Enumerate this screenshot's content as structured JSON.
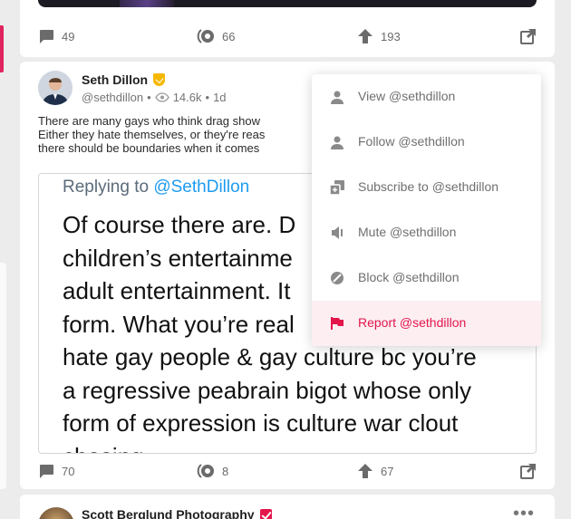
{
  "colors": {
    "accent": "#e3154b",
    "link": "#1d9bf0",
    "gold": "#f5b800",
    "background": "#ececec"
  },
  "post_above": {
    "comments": "49",
    "views": "66",
    "upvotes": "193"
  },
  "post": {
    "author_name": "Seth Dillon",
    "handle": "@sethdillon",
    "separator": "•",
    "views": "14.6k",
    "age": "1d",
    "text_lines": [
      "There are many gays who think drag show",
      "Either they hate themselves, or they're reas",
      "there should be boundaries when it comes"
    ],
    "quote": {
      "replying_to_prefix": "Replying to",
      "replying_to_handle": "@SethDillon",
      "lines": [
        "Of course there are. D",
        "children’s entertainme",
        "adult entertainment. It",
        "form. What you’re real",
        "hate gay people & gay culture bc you’re",
        "a regressive peabrain bigot whose only",
        "form of expression is culture war clout",
        "chasing"
      ]
    },
    "comments": "70",
    "reposts": "8",
    "upvotes": "67"
  },
  "menu": {
    "items": [
      {
        "label": "View @sethdillon",
        "icon": "person-icon"
      },
      {
        "label": "Follow @sethdillon",
        "icon": "person-add-icon"
      },
      {
        "label": "Subscribe to @sethdillon",
        "icon": "subscribe-icon"
      },
      {
        "label": "Mute @sethdillon",
        "icon": "mute-icon"
      },
      {
        "label": "Block @sethdillon",
        "icon": "block-icon"
      },
      {
        "label": "Report @sethdillon",
        "icon": "flag-icon"
      }
    ]
  },
  "next_post": {
    "author_name": "Scott Berglund Photography",
    "more": "•••"
  }
}
